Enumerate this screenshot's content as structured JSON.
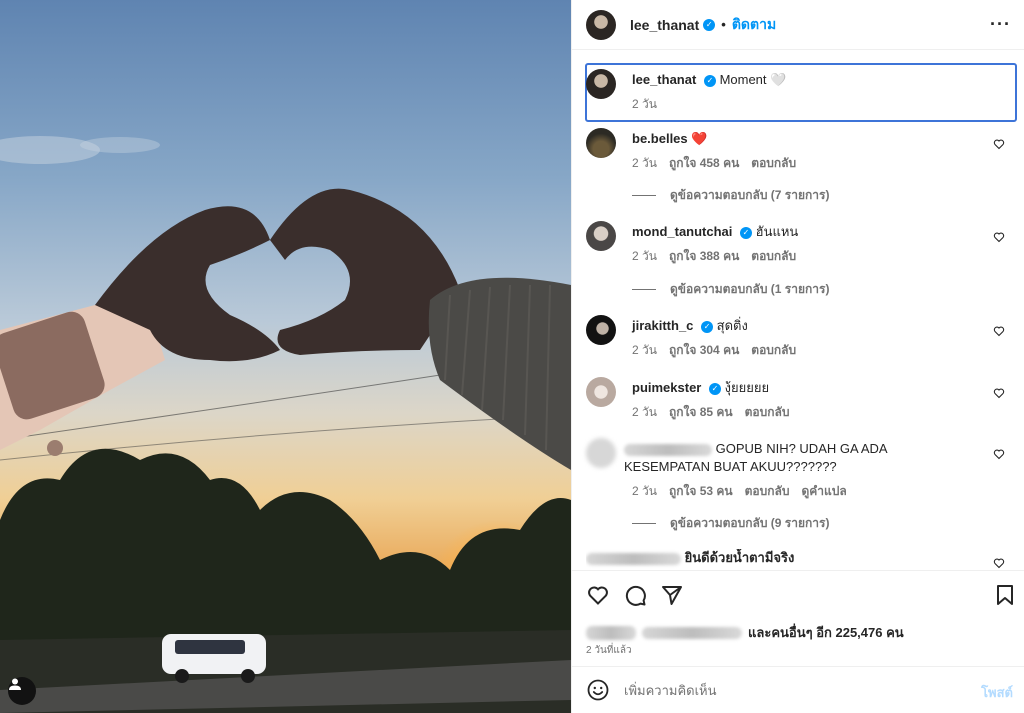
{
  "post": {
    "author": "lee_thanat",
    "follow_label": "ติดตาม",
    "more_icon": "more-horizontal-icon",
    "caption_text": "Moment 🤍",
    "caption_time": "2 วัน"
  },
  "comments": [
    {
      "user": "be.belles",
      "text": "❤️",
      "verified": false,
      "time": "2 วัน",
      "likes": "ถูกใจ 458 คน",
      "reply": "ตอบกลับ",
      "view_replies": "ดูข้อความตอบกลับ (7 รายการ)"
    },
    {
      "user": "mond_tanutchai",
      "text": "ฮันแหน",
      "verified": true,
      "time": "2 วัน",
      "likes": "ถูกใจ 388 คน",
      "reply": "ตอบกลับ",
      "view_replies": "ดูข้อความตอบกลับ (1 รายการ)"
    },
    {
      "user": "jirakitth_c",
      "text": "สุดติ่ง",
      "verified": true,
      "time": "2 วัน",
      "likes": "ถูกใจ 304 คน",
      "reply": "ตอบกลับ"
    },
    {
      "user": "puimekster",
      "text": "งุ้ยยยยย",
      "verified": true,
      "time": "2 วัน",
      "likes": "ถูกใจ 85 คน",
      "reply": "ตอบกลับ"
    },
    {
      "user": "",
      "text": "GOPUB NIH? UDAH GA ADA KESEMPATAN BUAT AKUU???????",
      "verified": false,
      "time": "2 วัน",
      "likes": "ถูกใจ 53 คน",
      "reply": "ตอบกลับ",
      "translate": "ดูคำแปล",
      "view_replies": "ดูข้อความตอบกลับ (9 รายการ)"
    },
    {
      "user": "",
      "text": "ยินดีด้วยน้ำตามีจริง",
      "verified": false
    }
  ],
  "likes_summary": "และคนอื่นๆ อีก 225,476 คน",
  "posted_ago": "2 วันที่แล้ว",
  "composer": {
    "placeholder": "เพิ่มความคิดเห็น",
    "post_label": "โพสต์"
  },
  "colors": {
    "accent": "#0095f6",
    "focus_border": "#3d74d8",
    "muted": "#737373"
  }
}
